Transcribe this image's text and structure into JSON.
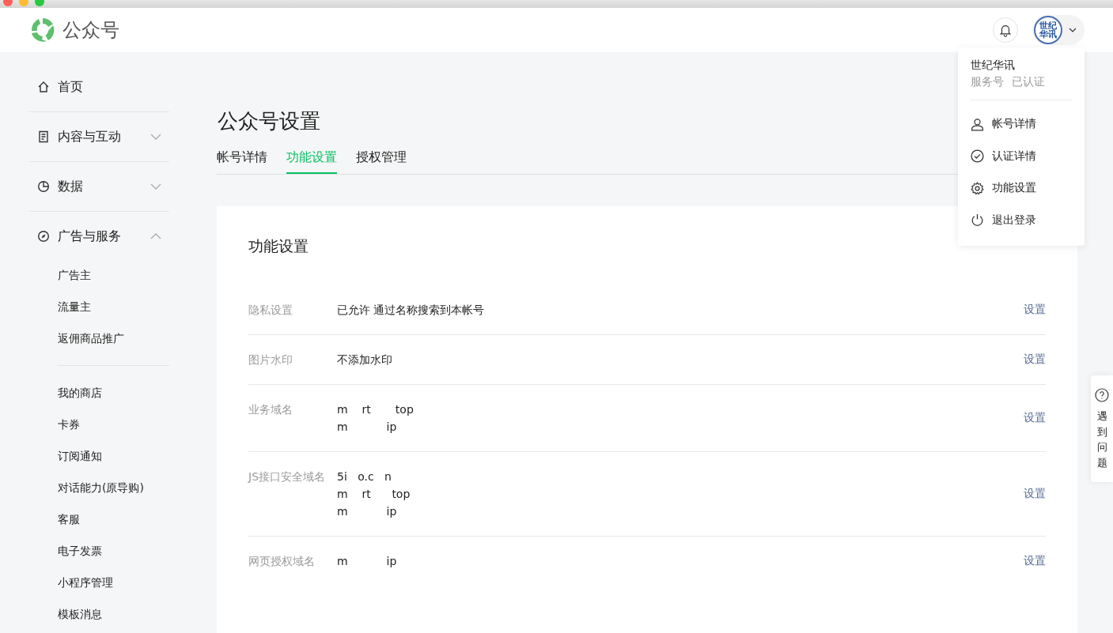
{
  "header": {
    "app_name": "公众号",
    "avatar_text": "世纪华讯"
  },
  "sidebar": {
    "items": [
      {
        "label": "首页"
      },
      {
        "label": "内容与互动",
        "expanded": false
      },
      {
        "label": "数据",
        "expanded": false
      },
      {
        "label": "广告与服务",
        "expanded": true,
        "children": [
          {
            "label": "广告主"
          },
          {
            "label": "流量主"
          },
          {
            "label": "返佣商品推广"
          },
          {
            "label": "我的商店",
            "divider_before": true
          },
          {
            "label": "卡券"
          },
          {
            "label": "订阅通知"
          },
          {
            "label": "对话能力(原导购)"
          },
          {
            "label": "客服"
          },
          {
            "label": "电子发票"
          },
          {
            "label": "小程序管理"
          },
          {
            "label": "模板消息"
          }
        ]
      }
    ]
  },
  "page": {
    "title": "公众号设置",
    "tabs": [
      {
        "label": "帐号详情",
        "selected": false
      },
      {
        "label": "功能设置",
        "selected": true
      },
      {
        "label": "授权管理",
        "selected": false
      }
    ],
    "card": {
      "title": "功能设置",
      "rows": [
        {
          "label": "隐私设置",
          "values": [
            "已允许 通过名称搜索到本帐号"
          ],
          "action": "设置"
        },
        {
          "label": "图片水印",
          "values": [
            "不添加水印"
          ],
          "action": "设置"
        },
        {
          "label": "业务域名",
          "values": [
            "m    rt       top",
            "m           ip"
          ],
          "action": "设置"
        },
        {
          "label": "JS接口安全域名",
          "values": [
            "5i   o.c   n",
            "m    rt      top",
            "m           ip"
          ],
          "action": "设置"
        },
        {
          "label": "网页授权域名",
          "values": [
            "m           ip"
          ],
          "action": "设置"
        }
      ]
    }
  },
  "account_menu": {
    "name": "世纪华讯",
    "type": "服务号",
    "status": "已认证",
    "items": [
      {
        "label": "帐号详情"
      },
      {
        "label": "认证详情"
      },
      {
        "label": "功能设置"
      },
      {
        "label": "退出登录"
      }
    ]
  },
  "help_tab": {
    "label": "遇到问题"
  }
}
